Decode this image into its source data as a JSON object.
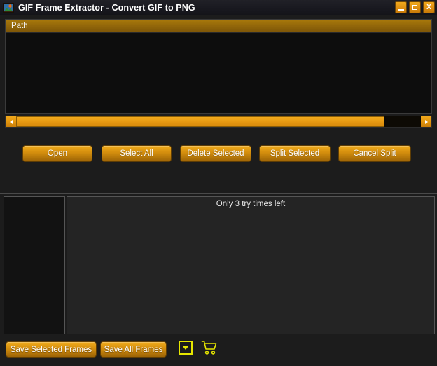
{
  "window": {
    "title": "GIF Frame Extractor - Convert GIF to PNG",
    "app_icon": "image-thumbnail-icon",
    "controls": {
      "minimize": "minimize-icon",
      "maximize": "maximize-icon",
      "close": "X"
    },
    "accent_color": "#e89a12",
    "highlight_color": "#e6e600",
    "background_color": "#1c1c1c"
  },
  "list_panel": {
    "column_header": "Path",
    "rows": []
  },
  "scrollbar": {
    "left_arrow": "chevron-left-icon",
    "right_arrow": "chevron-right-icon",
    "thumb_fraction": 91
  },
  "actions": {
    "open": "Open",
    "select_all": "Select All",
    "delete_selected": "Delete Selected",
    "split_selected": "Split Selected",
    "cancel_split": "Cancel Split"
  },
  "status": {
    "message": "Only 3 try times left"
  },
  "bottom": {
    "save_selected": "Save Selected Frames",
    "save_all": "Save All Frames",
    "dropdown": "chevron-down-icon",
    "cart": "shopping-cart-icon"
  }
}
